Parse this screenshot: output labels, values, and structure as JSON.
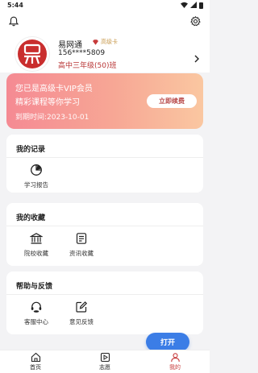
{
  "status_bar": {
    "time": "5:44"
  },
  "user": {
    "name": "易网通",
    "vip_label": "高级卡",
    "phone": "156****5809",
    "class": "高中三年级(50)班"
  },
  "vip_card": {
    "title": "您已是高级卡VIP会员",
    "subtitle": "精彩课程等你学习",
    "expire": "到期时间:2023-10-01",
    "renew_label": "立即续费"
  },
  "records": {
    "title": "我的记录",
    "items": [
      {
        "label": "学习报告",
        "icon": "pie-chart-icon"
      }
    ]
  },
  "favorites": {
    "title": "我的收藏",
    "items": [
      {
        "label": "院校收藏",
        "icon": "school-icon"
      },
      {
        "label": "资讯收藏",
        "icon": "news-icon"
      }
    ]
  },
  "help": {
    "title": "帮助与反馈",
    "items": [
      {
        "label": "客服中心",
        "icon": "headset-icon"
      },
      {
        "label": "意见反馈",
        "icon": "edit-icon"
      }
    ]
  },
  "open_button": "打开",
  "tabs": [
    {
      "label": "首页",
      "icon": "home-icon",
      "active": false
    },
    {
      "label": "志愿",
      "icon": "volunteer-icon",
      "active": false
    },
    {
      "label": "我的",
      "icon": "profile-icon",
      "active": true
    }
  ],
  "colors": {
    "accent": "#c73b3b",
    "button_blue": "#3b7de6",
    "vip_gradient_start": "#f58a93",
    "vip_gradient_end": "#fac7a1"
  }
}
